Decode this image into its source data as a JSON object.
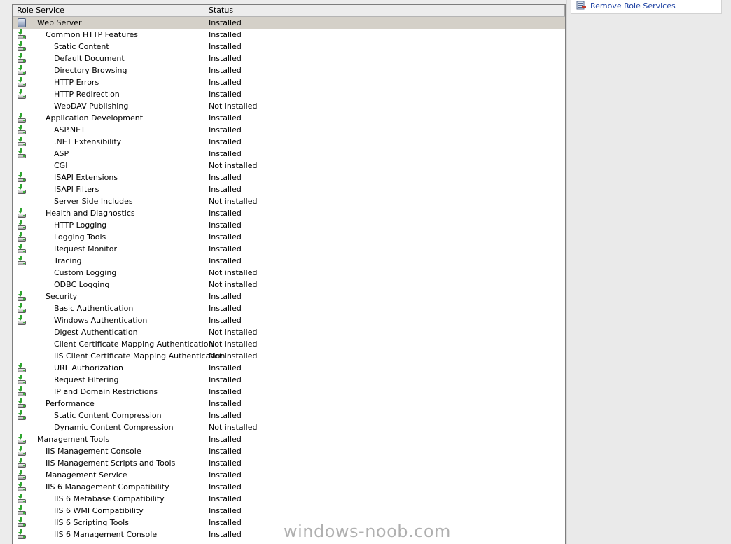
{
  "actions": {
    "remove_role_services": "Remove Role Services",
    "remove_icon": "remove-role-services-icon"
  },
  "columns": {
    "role_service": "Role Service",
    "status": "Status"
  },
  "rows": [
    {
      "name": "Web Server",
      "status": "Installed",
      "level": 0,
      "icon": "server-icon",
      "selected": true
    },
    {
      "name": "Common HTTP Features",
      "status": "Installed",
      "level": 1,
      "icon": "install-icon"
    },
    {
      "name": "Static Content",
      "status": "Installed",
      "level": 2,
      "icon": "install-icon"
    },
    {
      "name": "Default Document",
      "status": "Installed",
      "level": 2,
      "icon": "install-icon"
    },
    {
      "name": "Directory Browsing",
      "status": "Installed",
      "level": 2,
      "icon": "install-icon"
    },
    {
      "name": "HTTP Errors",
      "status": "Installed",
      "level": 2,
      "icon": "install-icon"
    },
    {
      "name": "HTTP Redirection",
      "status": "Installed",
      "level": 2,
      "icon": "install-icon"
    },
    {
      "name": "WebDAV Publishing",
      "status": "Not installed",
      "level": 2,
      "icon": ""
    },
    {
      "name": "Application Development",
      "status": "Installed",
      "level": 1,
      "icon": "install-icon"
    },
    {
      "name": "ASP.NET",
      "status": "Installed",
      "level": 2,
      "icon": "install-icon"
    },
    {
      "name": ".NET Extensibility",
      "status": "Installed",
      "level": 2,
      "icon": "install-icon"
    },
    {
      "name": "ASP",
      "status": "Installed",
      "level": 2,
      "icon": "install-icon"
    },
    {
      "name": "CGI",
      "status": "Not installed",
      "level": 2,
      "icon": ""
    },
    {
      "name": "ISAPI Extensions",
      "status": "Installed",
      "level": 2,
      "icon": "install-icon"
    },
    {
      "name": "ISAPI Filters",
      "status": "Installed",
      "level": 2,
      "icon": "install-icon"
    },
    {
      "name": "Server Side Includes",
      "status": "Not installed",
      "level": 2,
      "icon": ""
    },
    {
      "name": "Health and Diagnostics",
      "status": "Installed",
      "level": 1,
      "icon": "install-icon"
    },
    {
      "name": "HTTP Logging",
      "status": "Installed",
      "level": 2,
      "icon": "install-icon"
    },
    {
      "name": "Logging Tools",
      "status": "Installed",
      "level": 2,
      "icon": "install-icon"
    },
    {
      "name": "Request Monitor",
      "status": "Installed",
      "level": 2,
      "icon": "install-icon"
    },
    {
      "name": "Tracing",
      "status": "Installed",
      "level": 2,
      "icon": "install-icon"
    },
    {
      "name": "Custom Logging",
      "status": "Not installed",
      "level": 2,
      "icon": ""
    },
    {
      "name": "ODBC Logging",
      "status": "Not installed",
      "level": 2,
      "icon": ""
    },
    {
      "name": "Security",
      "status": "Installed",
      "level": 1,
      "icon": "install-icon"
    },
    {
      "name": "Basic Authentication",
      "status": "Installed",
      "level": 2,
      "icon": "install-icon"
    },
    {
      "name": "Windows Authentication",
      "status": "Installed",
      "level": 2,
      "icon": "install-icon"
    },
    {
      "name": "Digest Authentication",
      "status": "Not installed",
      "level": 2,
      "icon": ""
    },
    {
      "name": "Client Certificate Mapping Authentication",
      "status": "Not installed",
      "level": 2,
      "icon": ""
    },
    {
      "name": "IIS Client Certificate Mapping Authentication",
      "status": "Not installed",
      "level": 2,
      "icon": ""
    },
    {
      "name": "URL Authorization",
      "status": "Installed",
      "level": 2,
      "icon": "install-icon"
    },
    {
      "name": "Request Filtering",
      "status": "Installed",
      "level": 2,
      "icon": "install-icon"
    },
    {
      "name": "IP and Domain Restrictions",
      "status": "Installed",
      "level": 2,
      "icon": "install-icon"
    },
    {
      "name": "Performance",
      "status": "Installed",
      "level": 1,
      "icon": "install-icon"
    },
    {
      "name": "Static Content Compression",
      "status": "Installed",
      "level": 2,
      "icon": "install-icon"
    },
    {
      "name": "Dynamic Content Compression",
      "status": "Not installed",
      "level": 2,
      "icon": ""
    },
    {
      "name": "Management Tools",
      "status": "Installed",
      "level": 0,
      "icon": "install-icon"
    },
    {
      "name": "IIS Management Console",
      "status": "Installed",
      "level": 1,
      "icon": "install-icon"
    },
    {
      "name": "IIS Management Scripts and Tools",
      "status": "Installed",
      "level": 1,
      "icon": "install-icon"
    },
    {
      "name": "Management Service",
      "status": "Installed",
      "level": 1,
      "icon": "install-icon"
    },
    {
      "name": "IIS 6 Management Compatibility",
      "status": "Installed",
      "level": 1,
      "icon": "install-icon"
    },
    {
      "name": "IIS 6 Metabase Compatibility",
      "status": "Installed",
      "level": 2,
      "icon": "install-icon"
    },
    {
      "name": "IIS 6 WMI Compatibility",
      "status": "Installed",
      "level": 2,
      "icon": "install-icon"
    },
    {
      "name": "IIS 6 Scripting Tools",
      "status": "Installed",
      "level": 2,
      "icon": "install-icon"
    },
    {
      "name": "IIS 6 Management Console",
      "status": "Installed",
      "level": 2,
      "icon": "install-icon"
    }
  ],
  "watermark": "windows-noob.com",
  "colors": {
    "installed_icon_arrow": "#2fa52f",
    "selected_row_bg": "#d4d0c8",
    "action_link": "#1b3fa1"
  }
}
